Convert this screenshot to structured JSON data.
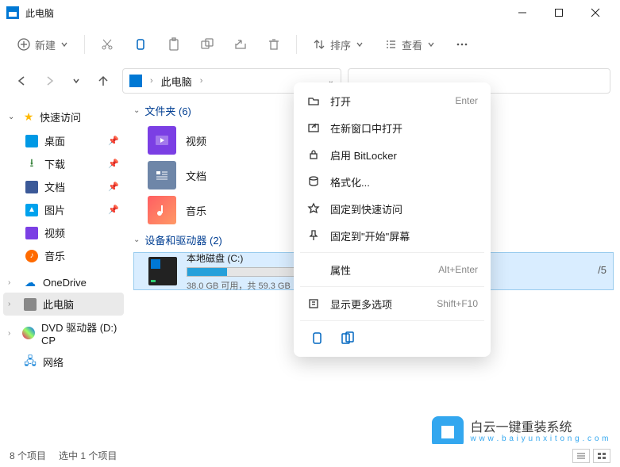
{
  "window": {
    "title": "此电脑"
  },
  "toolbar": {
    "new_label": "新建",
    "sort_label": "排序",
    "view_label": "查看"
  },
  "address": {
    "crumb": "此电脑"
  },
  "sidebar": {
    "quick": {
      "label": "快速访问",
      "items": [
        {
          "label": "桌面"
        },
        {
          "label": "下载"
        },
        {
          "label": "文档"
        },
        {
          "label": "图片"
        },
        {
          "label": "视频"
        },
        {
          "label": "音乐"
        }
      ]
    },
    "onedrive": "OneDrive",
    "thispc": "此电脑",
    "dvd": "DVD 驱动器 (D:) CP",
    "network": "网络"
  },
  "content": {
    "folders_head": "文件夹 (6)",
    "folders": [
      {
        "label": "视频"
      },
      {
        "label": "文档"
      },
      {
        "label": "音乐"
      }
    ],
    "devices_head": "设备和驱动器 (2)",
    "drive": {
      "name": "本地磁盘 (C:)",
      "sub": "38.0 GB 可用，共 59.3 GB",
      "trail": "/5"
    }
  },
  "ctx": {
    "items": [
      {
        "label": "打开",
        "shortcut": "Enter"
      },
      {
        "label": "在新窗口中打开",
        "shortcut": ""
      },
      {
        "label": "启用 BitLocker",
        "shortcut": ""
      },
      {
        "label": "格式化...",
        "shortcut": ""
      },
      {
        "label": "固定到快速访问",
        "shortcut": ""
      },
      {
        "label": "固定到\"开始\"屏幕",
        "shortcut": ""
      },
      {
        "label": "属性",
        "shortcut": "Alt+Enter"
      },
      {
        "label": "显示更多选项",
        "shortcut": "Shift+F10"
      }
    ]
  },
  "status": {
    "count": "8 个项目",
    "selected": "选中 1 个项目"
  },
  "watermark": {
    "line1": "白云一键重装系统",
    "line2": "w w w . b a i y u n x i t o n g . c o m"
  }
}
